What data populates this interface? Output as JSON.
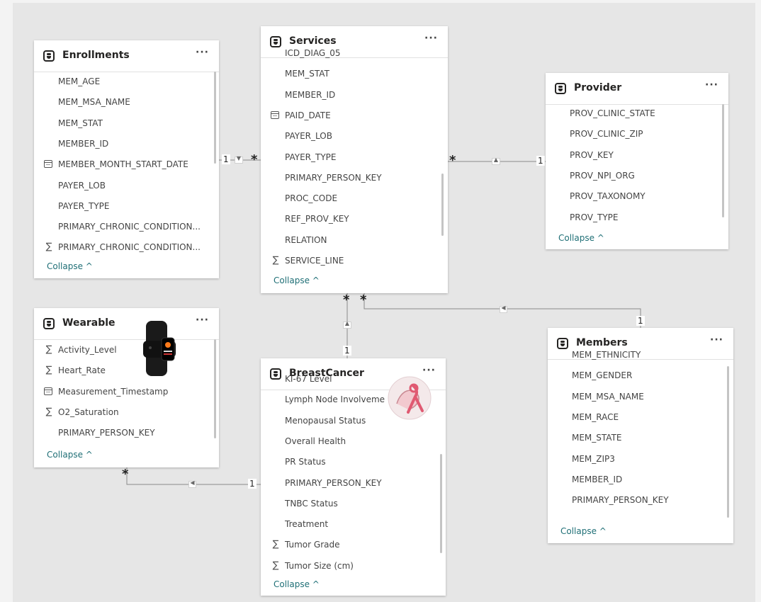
{
  "tables": {
    "enrollments": {
      "title": "Enrollments",
      "more": "···",
      "collapse": "Collapse ^",
      "fields": [
        {
          "icon": "",
          "name": "MEM_AGE"
        },
        {
          "icon": "",
          "name": "MEM_MSA_NAME"
        },
        {
          "icon": "",
          "name": "MEM_STAT"
        },
        {
          "icon": "",
          "name": "MEMBER_ID"
        },
        {
          "icon": "calendar-icon",
          "name": "MEMBER_MONTH_START_DATE"
        },
        {
          "icon": "",
          "name": "PAYER_LOB"
        },
        {
          "icon": "",
          "name": "PAYER_TYPE"
        },
        {
          "icon": "",
          "name": "PRIMARY_CHRONIC_CONDITION..."
        },
        {
          "icon": "sigma-icon",
          "name": "PRIMARY_CHRONIC_CONDITION..."
        }
      ]
    },
    "services": {
      "title": "Services",
      "more": "···",
      "collapse": "Collapse ^",
      "fields": [
        {
          "icon": "",
          "name": "ICD_DIAG_05"
        },
        {
          "icon": "",
          "name": "MEM_STAT"
        },
        {
          "icon": "",
          "name": "MEMBER_ID"
        },
        {
          "icon": "calendar-icon",
          "name": "PAID_DATE"
        },
        {
          "icon": "",
          "name": "PAYER_LOB"
        },
        {
          "icon": "",
          "name": "PAYER_TYPE"
        },
        {
          "icon": "",
          "name": "PRIMARY_PERSON_KEY"
        },
        {
          "icon": "",
          "name": "PROC_CODE"
        },
        {
          "icon": "",
          "name": "REF_PROV_KEY"
        },
        {
          "icon": "",
          "name": "RELATION"
        },
        {
          "icon": "sigma-icon",
          "name": "SERVICE_LINE"
        }
      ]
    },
    "provider": {
      "title": "Provider",
      "more": "···",
      "collapse": "Collapse ^",
      "fields": [
        {
          "icon": "",
          "name": "PROV_CLINIC_STATE"
        },
        {
          "icon": "",
          "name": "PROV_CLINIC_ZIP"
        },
        {
          "icon": "",
          "name": "PROV_KEY"
        },
        {
          "icon": "",
          "name": "PROV_NPI_ORG"
        },
        {
          "icon": "",
          "name": "PROV_TAXONOMY"
        },
        {
          "icon": "",
          "name": "PROV_TYPE"
        }
      ]
    },
    "wearable": {
      "title": "Wearable",
      "more": "···",
      "collapse": "Collapse ^",
      "fields": [
        {
          "icon": "sigma-icon",
          "name": "Activity_Level"
        },
        {
          "icon": "sigma-icon",
          "name": "Heart_Rate"
        },
        {
          "icon": "calendar-icon",
          "name": "Measurement_Timestamp"
        },
        {
          "icon": "sigma-icon",
          "name": "O2_Saturation"
        },
        {
          "icon": "",
          "name": "PRIMARY_PERSON_KEY"
        }
      ]
    },
    "breastcancer": {
      "title": "BreastCancer",
      "more": "···",
      "collapse": "Collapse ^",
      "fields": [
        {
          "icon": "",
          "name": "KI-67 Level"
        },
        {
          "icon": "",
          "name": "Lymph Node Involveme"
        },
        {
          "icon": "",
          "name": "Menopausal Status"
        },
        {
          "icon": "",
          "name": "Overall Health"
        },
        {
          "icon": "",
          "name": "PR Status"
        },
        {
          "icon": "",
          "name": "PRIMARY_PERSON_KEY"
        },
        {
          "icon": "",
          "name": "TNBC Status"
        },
        {
          "icon": "",
          "name": "Treatment"
        },
        {
          "icon": "sigma-icon",
          "name": "Tumor Grade"
        },
        {
          "icon": "sigma-icon",
          "name": "Tumor Size (cm)"
        }
      ]
    },
    "members": {
      "title": "Members",
      "more": "···",
      "collapse": "Collapse ^",
      "fields": [
        {
          "icon": "",
          "name": "MEM_ETHNICITY"
        },
        {
          "icon": "",
          "name": "MEM_GENDER"
        },
        {
          "icon": "",
          "name": "MEM_MSA_NAME"
        },
        {
          "icon": "",
          "name": "MEM_RACE"
        },
        {
          "icon": "",
          "name": "MEM_STATE"
        },
        {
          "icon": "",
          "name": "MEM_ZIP3"
        },
        {
          "icon": "",
          "name": "MEMBER_ID"
        },
        {
          "icon": "",
          "name": "PRIMARY_PERSON_KEY"
        }
      ]
    }
  },
  "relationships": {
    "one": "1",
    "many": "*"
  }
}
